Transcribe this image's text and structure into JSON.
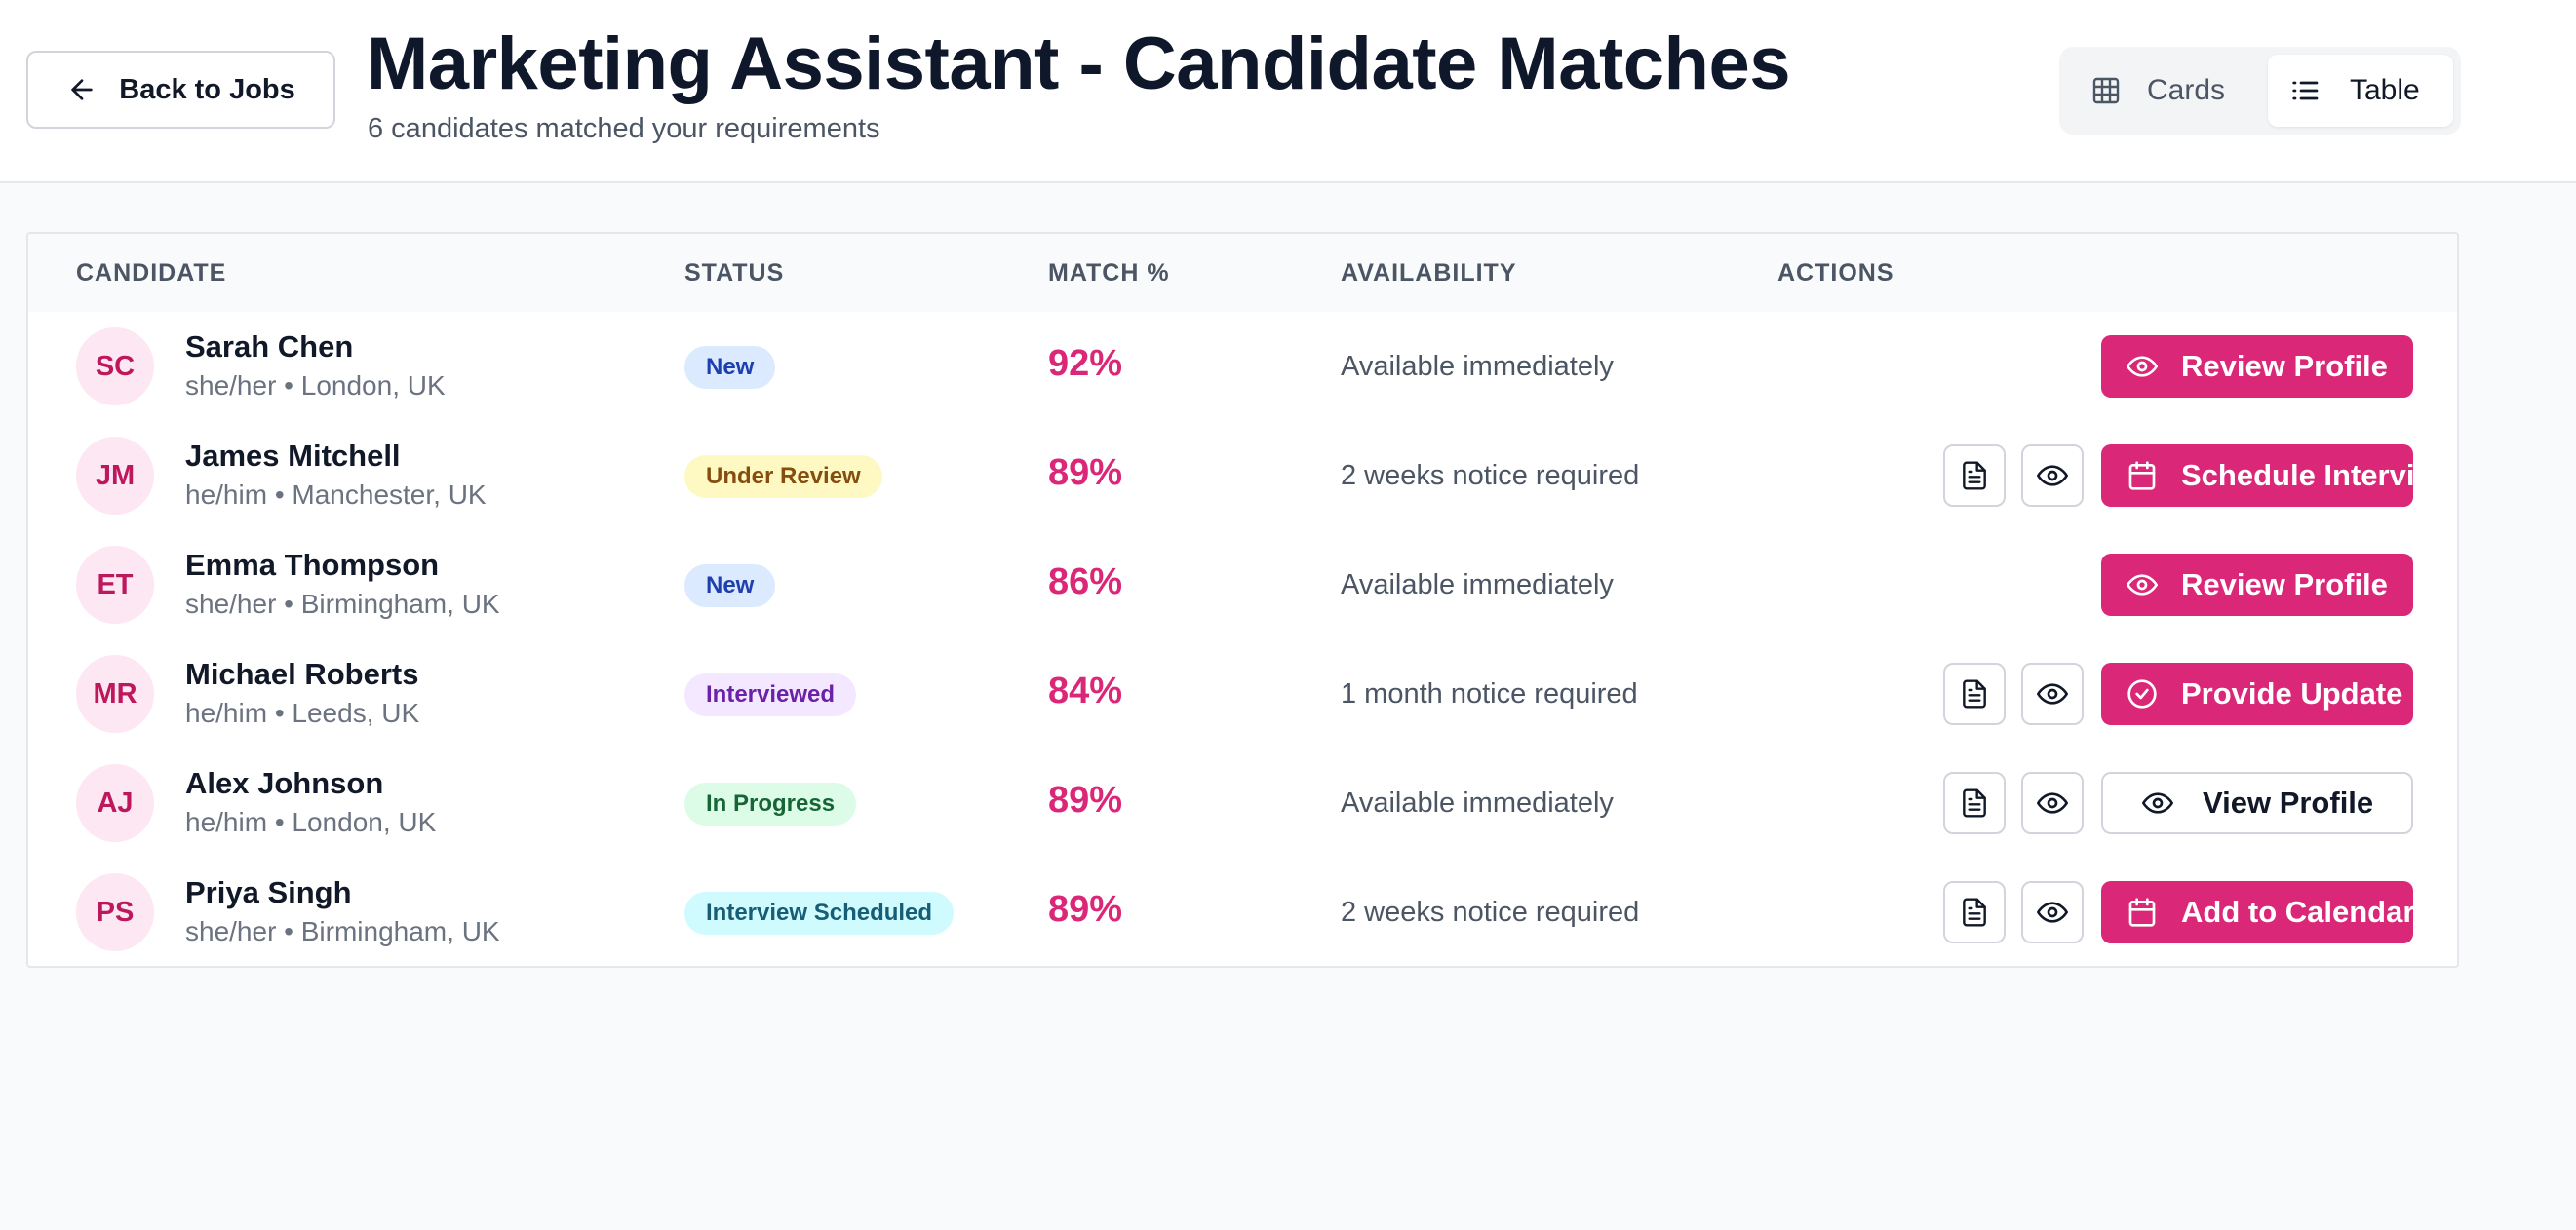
{
  "header": {
    "back_label": "Back to Jobs",
    "title": "Marketing Assistant - Candidate Matches",
    "subtitle": "6 candidates matched your requirements",
    "view_toggle": {
      "cards_label": "Cards",
      "table_label": "Table",
      "selected": "Table"
    }
  },
  "table": {
    "columns": [
      "CANDIDATE",
      "STATUS",
      "MATCH %",
      "AVAILABILITY",
      "ACTIONS"
    ],
    "rows": [
      {
        "initials": "SC",
        "name": "Sarah Chen",
        "meta": "she/her • London, UK",
        "status": "New",
        "match": "92%",
        "availability": "Available immediately",
        "action": "Review Profile",
        "action_icon": "eye-icon",
        "action_style": "primary",
        "show_icon_buttons": false
      },
      {
        "initials": "JM",
        "name": "James Mitchell",
        "meta": "he/him • Manchester, UK",
        "status": "Under Review",
        "match": "89%",
        "availability": "2 weeks notice required",
        "action": "Schedule Interview",
        "action_icon": "calendar-icon",
        "action_style": "primary",
        "show_icon_buttons": true
      },
      {
        "initials": "ET",
        "name": "Emma Thompson",
        "meta": "she/her • Birmingham, UK",
        "status": "New",
        "match": "86%",
        "availability": "Available immediately",
        "action": "Review Profile",
        "action_icon": "eye-icon",
        "action_style": "primary",
        "show_icon_buttons": false
      },
      {
        "initials": "MR",
        "name": "Michael Roberts",
        "meta": "he/him • Leeds, UK",
        "status": "Interviewed",
        "match": "84%",
        "availability": "1 month notice required",
        "action": "Provide Update",
        "action_icon": "check-circle-icon",
        "action_style": "primary",
        "show_icon_buttons": true
      },
      {
        "initials": "AJ",
        "name": "Alex Johnson",
        "meta": "he/him • London, UK",
        "status": "In Progress",
        "match": "89%",
        "availability": "Available immediately",
        "action": "View Profile",
        "action_icon": "eye-icon",
        "action_style": "outline",
        "show_icon_buttons": true
      },
      {
        "initials": "PS",
        "name": "Priya Singh",
        "meta": "she/her • Birmingham, UK",
        "status": "Interview Scheduled",
        "match": "89%",
        "availability": "2 weeks notice required",
        "action": "Add to Calendar",
        "action_icon": "calendar-icon",
        "action_style": "primary",
        "show_icon_buttons": true
      }
    ]
  },
  "status_colors": {
    "New": {
      "bg": "#dbeafe",
      "fg": "#1e40af"
    },
    "Under Review": {
      "bg": "#fef9c3",
      "fg": "#854d0e"
    },
    "Interviewed": {
      "bg": "#f3e8ff",
      "fg": "#6b21a8"
    },
    "In Progress": {
      "bg": "#dcfce7",
      "fg": "#166534"
    },
    "Interview Scheduled": {
      "bg": "#cffafe",
      "fg": "#155e75"
    }
  },
  "colors": {
    "accent": "#db2777",
    "avatar_bg": "#fce7f3",
    "avatar_fg": "#be185d"
  }
}
